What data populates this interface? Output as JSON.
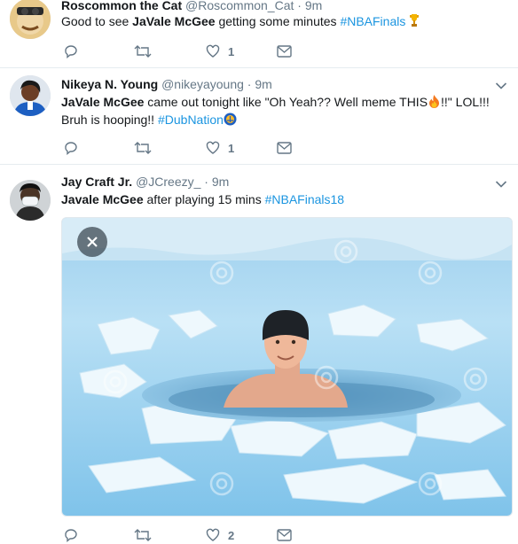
{
  "tweets": [
    {
      "name": "Roscommon the Cat",
      "handle": "@Roscommon_Cat",
      "time": "· 9m",
      "text_pre": "Good to see ",
      "text_bold": "JaVale McGee",
      "text_mid": " getting some minutes ",
      "hashtag": "#NBAFinals",
      "likes": "1"
    },
    {
      "name": "Nikeya N. Young",
      "handle": "@nikeyayoung",
      "time": "· 9m",
      "text_bold": "JaVale McGee",
      "text_mid": " came out tonight like \"Oh Yeah?? Well meme THIS",
      "text_post": "!!\" LOL!!!",
      "line2_pre": "Bruh is hooping!! ",
      "hashtag": "#DubNation",
      "likes": "1"
    },
    {
      "name": "Jay Craft Jr.",
      "handle": "@JCreezy_",
      "time": "· 9m",
      "text_bold": "Javale McGee",
      "text_mid": " after playing 15 mins ",
      "hashtag": "#NBAFinals18",
      "likes": "2",
      "watermark": "dreamstime"
    }
  ],
  "colors": {
    "link": "#1b95e0",
    "muted": "#657786",
    "divider": "#e6ecf0"
  }
}
